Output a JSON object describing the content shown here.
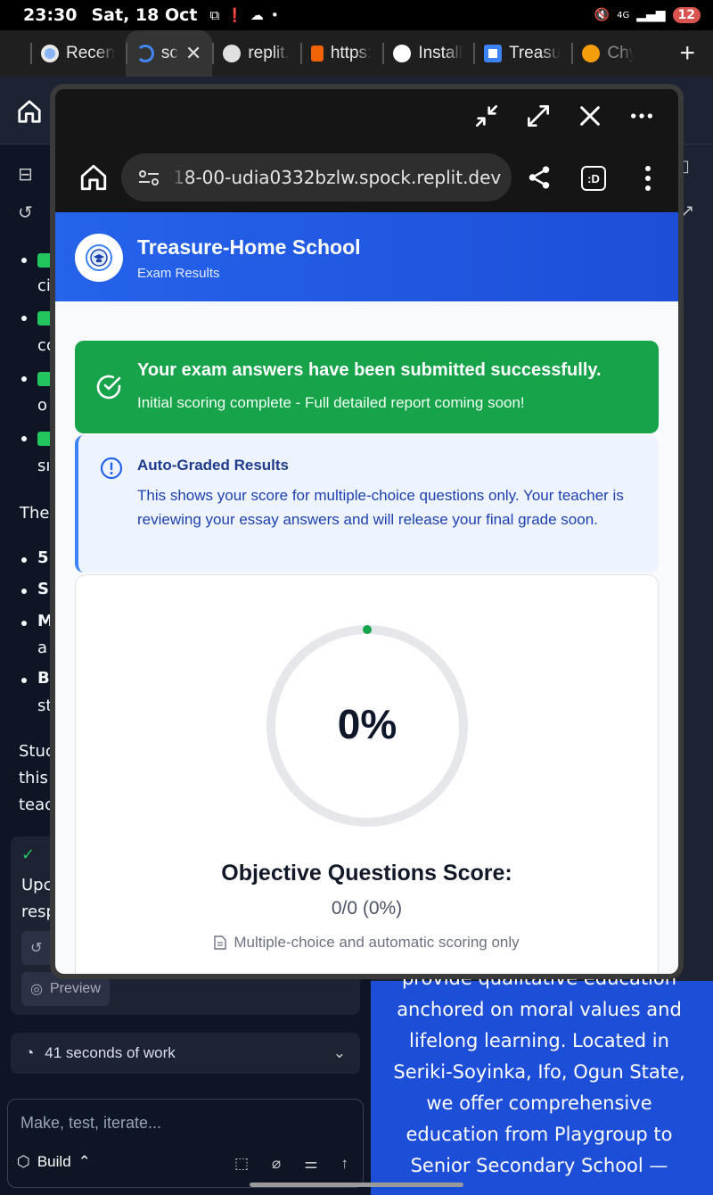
{
  "status_bar": {
    "time": "23:30",
    "date": "Sat, 18 Oct",
    "battery": "12"
  },
  "tabs": [
    {
      "label": "Recen",
      "active": false,
      "favicon_color": "#8ab4f8"
    },
    {
      "label": "sc",
      "active": true,
      "favicon_color": "#4285f4"
    },
    {
      "label": "replit.",
      "active": false,
      "favicon_color": "#e0e0e0"
    },
    {
      "label": "https:",
      "active": false,
      "favicon_color": "#f26207"
    },
    {
      "label": "Install",
      "active": false,
      "favicon_color": "#ffffff"
    },
    {
      "label": "Treasu",
      "active": false,
      "favicon_color": "#3b82f6"
    },
    {
      "label": "Chy",
      "active": false,
      "favicon_color": "#f59e0b"
    }
  ],
  "popup": {
    "url": "18-00-udia0332bzlw.spock.replit.dev",
    "ext_label": ":D"
  },
  "page": {
    "school_name": "Treasure-Home School",
    "subtitle": "Exam Results",
    "success": {
      "title": "Your exam answers have been submitted successfully.",
      "subtitle": "Initial scoring complete - Full detailed report coming soon!"
    },
    "info": {
      "title": "Auto-Graded Results",
      "body": "This shows your score for multiple-choice questions only. Your teacher is reviewing your essay answers and will release your final grade soon."
    },
    "score": {
      "percent_label": "0%",
      "percent_value": 0,
      "title": "Objective Questions Score:",
      "value": "0/0 (0%)",
      "note": "Multiple-choice and automatic scoring only"
    }
  },
  "background": {
    "peek_texts": [
      "ci",
      "cc",
      "o",
      "sı",
      "The",
      "5",
      "S",
      "M",
      "a",
      "B",
      "st",
      "Stuc",
      "this",
      "teac",
      "Upc",
      "resp"
    ],
    "chip_preview": "Preview",
    "work_label": "41 seconds of work",
    "input_placeholder": "Make, test, iterate...",
    "build_label": "Build",
    "preview_text": "provide qualitative education anchored on moral values and lifelong learning. Located in Seriki-Soyinka, Ifo, Ogun State, we offer comprehensive education from Playgroup to Senior Secondary School —"
  },
  "colors": {
    "header_blue": "#2563eb",
    "success_green": "#16a34a",
    "info_bg": "#eef4ff",
    "ring_track": "#e5e7eb"
  }
}
